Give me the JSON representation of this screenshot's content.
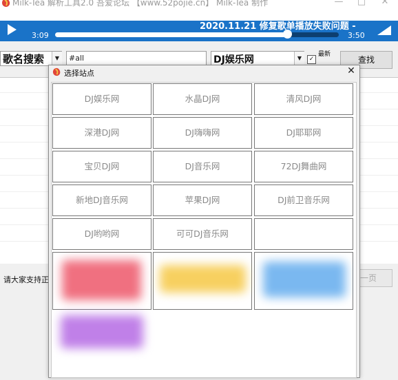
{
  "window": {
    "title": "Milk-Tea 解析工具2.0   吾爱论坛 【www.52pojie.cn】 Milk-Tea 制作",
    "minimize": "—",
    "maximize": "□",
    "close": "✕"
  },
  "player": {
    "marquee": "2020.11.21 修复歌单播放失败问题 -",
    "current_time": "3:09",
    "total_time": "3:50",
    "progress": 0.82
  },
  "toolbar": {
    "mode": "歌名搜索",
    "search_value": "#all",
    "site": "DJ娱乐网",
    "checkbox_label": "最新",
    "checkbox_mark": "✓",
    "dropdown_glyph": "▼",
    "search_button": "查找"
  },
  "status": {
    "text": "请大家支持正",
    "next_button": "一页"
  },
  "dialog": {
    "title": "选择站点",
    "close": "✕",
    "sites": [
      "DJ娱乐网",
      "水晶DJ网",
      "清风DJ网",
      "深港DJ网",
      "DJ嗨嗨网",
      "DJ耶耶网",
      "宝贝DJ网",
      "DJ音乐网",
      "72DJ舞曲网",
      "新地DJ音乐网",
      "苹果DJ网",
      "DJ前卫音乐网",
      "DJ哟哟网",
      "可可DJ音乐网",
      ""
    ]
  },
  "colors": {
    "accent": "#1a73c8",
    "ad_red": "#f07080",
    "ad_yellow": "#f7d060",
    "ad_blue": "#7ab8f0",
    "ad_purple": "#c080e8"
  }
}
